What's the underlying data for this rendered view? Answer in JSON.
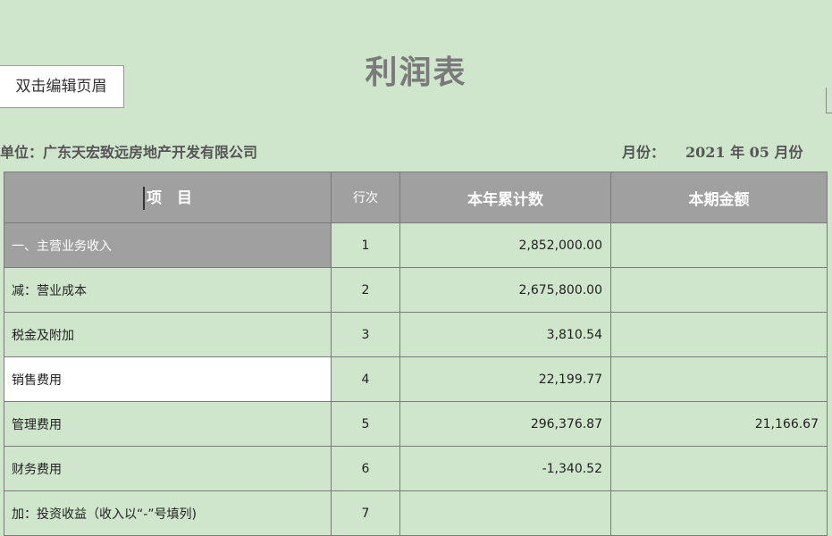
{
  "report": {
    "title": "利润表",
    "header_button": "双击编辑页眉",
    "unit_label": "单位：广东天宏致远房地产开发有限公司",
    "month_label": "月份：",
    "month_value": "2021 年 05 月份"
  },
  "table": {
    "columns": [
      "项　目",
      "行次",
      "本年累计数",
      "本期金额"
    ],
    "rows": [
      {
        "item": "一、主营业务收入",
        "line": "1",
        "ytd": "2,852,000.00",
        "current": ""
      },
      {
        "item": "减：营业成本",
        "line": "2",
        "ytd": "2,675,800.00",
        "current": ""
      },
      {
        "item": "税金及附加",
        "line": "3",
        "ytd": "3,810.54",
        "current": ""
      },
      {
        "item": "销售费用",
        "line": "4",
        "ytd": "22,199.77",
        "current": ""
      },
      {
        "item": "管理费用",
        "line": "5",
        "ytd": "296,376.87",
        "current": "21,166.67"
      },
      {
        "item": "财务费用",
        "line": "6",
        "ytd": "-1,340.52",
        "current": ""
      },
      {
        "item": "加：投资收益（收入以“-”号填列)",
        "line": "7",
        "ytd": "",
        "current": ""
      }
    ]
  }
}
